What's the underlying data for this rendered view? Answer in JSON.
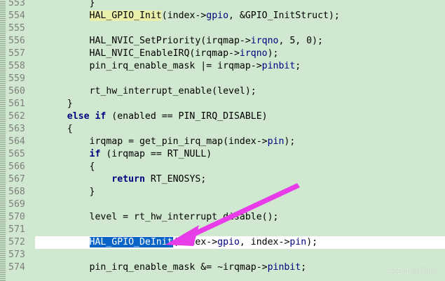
{
  "editor": {
    "lines": [
      {
        "num": "553",
        "segments": [
          {
            "t": "        }"
          }
        ]
      },
      {
        "num": "554",
        "segments": [
          {
            "t": "        "
          },
          {
            "t": "HAL_GPIO_Init",
            "c": "fn-hl"
          },
          {
            "t": "(index->"
          },
          {
            "t": "gpio",
            "c": "id"
          },
          {
            "t": ", &GPIO_InitStruct);"
          }
        ]
      },
      {
        "num": "555",
        "segments": [
          {
            "t": ""
          }
        ]
      },
      {
        "num": "556",
        "segments": [
          {
            "t": "        HAL_NVIC_SetPriority(irqmap->"
          },
          {
            "t": "irqno",
            "c": "id"
          },
          {
            "t": ", 5, 0);"
          }
        ]
      },
      {
        "num": "557",
        "segments": [
          {
            "t": "        HAL_NVIC_EnableIRQ(irqmap->"
          },
          {
            "t": "irqno",
            "c": "id"
          },
          {
            "t": ");"
          }
        ]
      },
      {
        "num": "558",
        "segments": [
          {
            "t": "        pin_irq_enable_mask |= irqmap->"
          },
          {
            "t": "pinbit",
            "c": "id"
          },
          {
            "t": ";"
          }
        ]
      },
      {
        "num": "559",
        "segments": [
          {
            "t": ""
          }
        ]
      },
      {
        "num": "560",
        "segments": [
          {
            "t": "        rt_hw_interrupt_enable(level);"
          }
        ]
      },
      {
        "num": "561",
        "segments": [
          {
            "t": "    }"
          }
        ]
      },
      {
        "num": "562",
        "segments": [
          {
            "t": "    "
          },
          {
            "t": "else if",
            "c": "kw"
          },
          {
            "t": " (enabled == PIN_IRQ_DISABLE)"
          }
        ]
      },
      {
        "num": "563",
        "segments": [
          {
            "t": "    {"
          }
        ]
      },
      {
        "num": "564",
        "segments": [
          {
            "t": "        irqmap = get_pin_irq_map(index->"
          },
          {
            "t": "pin",
            "c": "id"
          },
          {
            "t": ");"
          }
        ]
      },
      {
        "num": "565",
        "segments": [
          {
            "t": "        "
          },
          {
            "t": "if",
            "c": "kw"
          },
          {
            "t": " (irqmap == RT_NULL)"
          }
        ]
      },
      {
        "num": "566",
        "segments": [
          {
            "t": "        {"
          }
        ]
      },
      {
        "num": "567",
        "segments": [
          {
            "t": "            "
          },
          {
            "t": "return",
            "c": "kw"
          },
          {
            "t": " RT_ENOSYS;"
          }
        ]
      },
      {
        "num": "568",
        "segments": [
          {
            "t": "        }"
          }
        ]
      },
      {
        "num": "569",
        "segments": [
          {
            "t": ""
          }
        ]
      },
      {
        "num": "570",
        "segments": [
          {
            "t": "        level = rt_hw_interrupt_disable();"
          }
        ]
      },
      {
        "num": "571",
        "segments": [
          {
            "t": ""
          }
        ]
      },
      {
        "num": "572",
        "current": true,
        "segments": [
          {
            "t": "        "
          },
          {
            "t": "HAL_GPIO_DeInit",
            "c": "sel"
          },
          {
            "t": "(index->"
          },
          {
            "t": "gpio",
            "c": "id"
          },
          {
            "t": ", index->"
          },
          {
            "t": "pin",
            "c": "id"
          },
          {
            "t": ");"
          }
        ]
      },
      {
        "num": "573",
        "segments": [
          {
            "t": ""
          }
        ]
      },
      {
        "num": "574",
        "segments": [
          {
            "t": "        pin_irq_enable_mask &= ~irqmap->"
          },
          {
            "t": "pinbit",
            "c": "id"
          },
          {
            "t": ";"
          }
        ]
      }
    ]
  },
  "annotation": {
    "color": "#e83ce8"
  },
  "watermark": {
    "text": "CSDN @杨sir~"
  }
}
